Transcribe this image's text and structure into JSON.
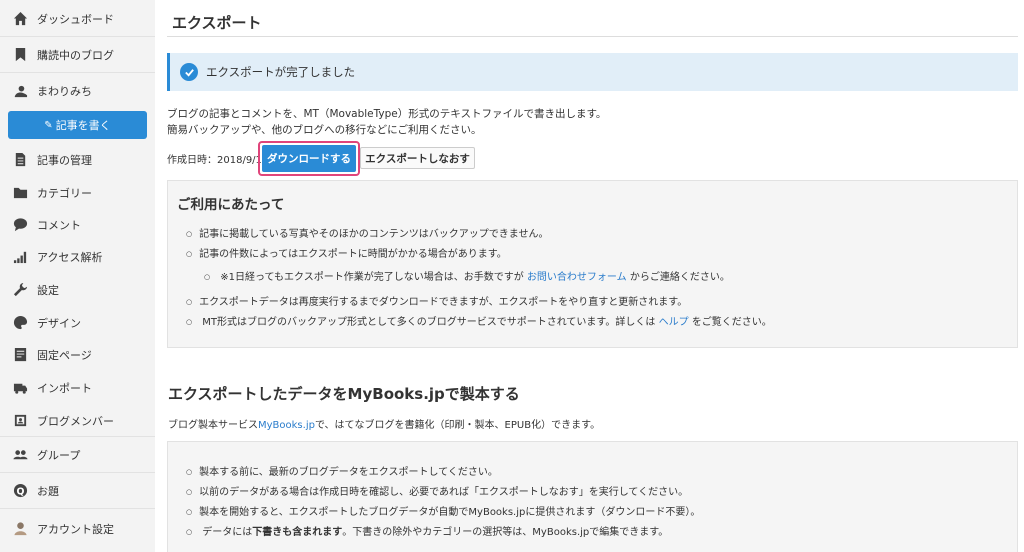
{
  "sidebar": {
    "items": [
      {
        "label": "ダッシュボード",
        "icon": "home-icon"
      },
      {
        "label": "購読中のブログ",
        "icon": "bookmark-icon"
      },
      {
        "label": "まわりみち",
        "icon": "blog-avatar-icon"
      },
      {
        "label": "記事の管理",
        "icon": "document-icon"
      },
      {
        "label": "カテゴリー",
        "icon": "folder-icon"
      },
      {
        "label": "コメント",
        "icon": "comment-icon"
      },
      {
        "label": "アクセス解析",
        "icon": "bar-chart-icon"
      },
      {
        "label": "設定",
        "icon": "wrench-icon"
      },
      {
        "label": "デザイン",
        "icon": "palette-icon"
      },
      {
        "label": "固定ページ",
        "icon": "page-icon"
      },
      {
        "label": "インポート",
        "icon": "truck-icon"
      },
      {
        "label": "ブログメンバー",
        "icon": "member-icon"
      },
      {
        "label": "グループ",
        "icon": "group-icon"
      },
      {
        "label": "お題",
        "icon": "question-icon"
      },
      {
        "label": "アカウント設定",
        "icon": "account-avatar-icon"
      }
    ],
    "write_button": "記事を書く"
  },
  "main": {
    "title": "エクスポート",
    "alert": "エクスポートが完了しました",
    "description_line1": "ブログの記事とコメントを、MT（MovableType）形式のテキストファイルで書き出します。",
    "description_line2": "簡易バックアップや、他のブログへの移行などにご利用ください。",
    "created_label": "作成日時：2018/9/15",
    "download_button": "ダウンロードする",
    "reexport_button": "エクスポートしなおす",
    "notes": {
      "title": "ご利用にあたって",
      "item1": "記事に掲載している写真やそのほかのコンテンツはバックアップできません。",
      "item2": "記事の件数によってはエクスポートに時間がかかる場合があります。",
      "item3_pre": "※1日経ってもエクスポート作業が完了しない場合は、お手数ですが",
      "item3_link": "お問い合わせフォーム",
      "item3_post": "からご連絡ください。",
      "item4": "エクスポートデータは再度実行するまでダウンロードできますが、エクスポートをやり直すと更新されます。",
      "item5_pre": "MT形式はブログのバックアップ形式として多くのブログサービスでサポートされています。詳しくは",
      "item5_link": "ヘルプ",
      "item5_post": "をご覧ください。"
    },
    "mybooks": {
      "title": "エクスポートしたデータをMyBooks.jpで製本する",
      "desc_pre": "ブログ製本サービス",
      "desc_link": "MyBooks.jp",
      "desc_post": "で、はてなブログを書籍化（印刷・製本、EPUB化）できます。",
      "item1": "製本する前に、最新のブログデータをエクスポートしてください。",
      "item2": "以前のデータがある場合は作成日時を確認し、必要であれば「エクスポートしなおす」を実行してください。",
      "item3": "製本を開始すると、エクスポートしたブログデータが自動でMyBooks.jpに提供されます（ダウンロード不要）。",
      "item4_pre": "データには",
      "item4_bold": "下書きも含まれます",
      "item4_post": "。下書きの除外やカテゴリーの選択等は、MyBooks.jpで編集できます。"
    }
  },
  "colors": {
    "accent": "#2a8bd6",
    "highlight_border": "#e0457b",
    "alert_bg": "#e1eef8",
    "sidebar_bg": "#f3f3f3"
  }
}
